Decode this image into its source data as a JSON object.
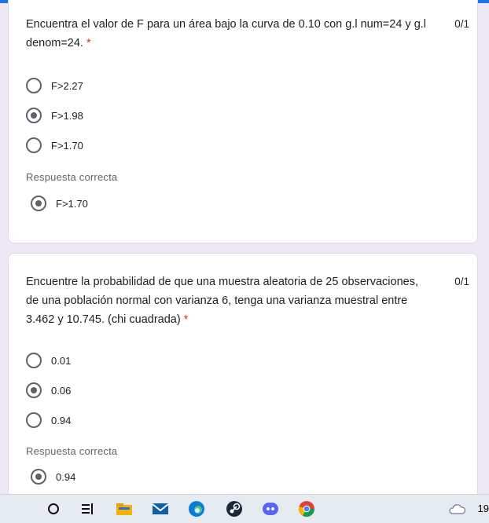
{
  "question1": {
    "text_line1": "Encuentra el valor de F para un área bajo la curva de 0.10 con g.l num=24 y g.l",
    "text_line2": "denom=24.",
    "required": "*",
    "score": "0/1",
    "options": [
      {
        "label": "F>2.27",
        "selected": false
      },
      {
        "label": "F>1.98",
        "selected": true
      },
      {
        "label": "F>1.70",
        "selected": false
      }
    ],
    "correct_title": "Respuesta correcta",
    "correct_answer": "F>1.70"
  },
  "question2": {
    "text_line1": "Encuentre la probabilidad de que una muestra aleatoria de 25 observaciones,",
    "text_line2": "de una población normal con varianza 6, tenga una varianza muestral entre",
    "text_line3": "3.462 y 10.745. (chi cuadrada)",
    "required": "*",
    "score": "0/1",
    "options": [
      {
        "label": "0.01",
        "selected": false
      },
      {
        "label": "0.06",
        "selected": true
      },
      {
        "label": "0.94",
        "selected": false
      }
    ],
    "correct_title": "Respuesta correcta",
    "correct_answer": "0.94"
  },
  "taskbar": {
    "icons": [
      "search-icon",
      "task-view-icon",
      "file-explorer-icon",
      "mail-icon",
      "edge-icon",
      "steam-icon",
      "discord-icon",
      "chrome-icon"
    ],
    "weather_icon": "cloud-icon",
    "clock_partial": "19"
  }
}
